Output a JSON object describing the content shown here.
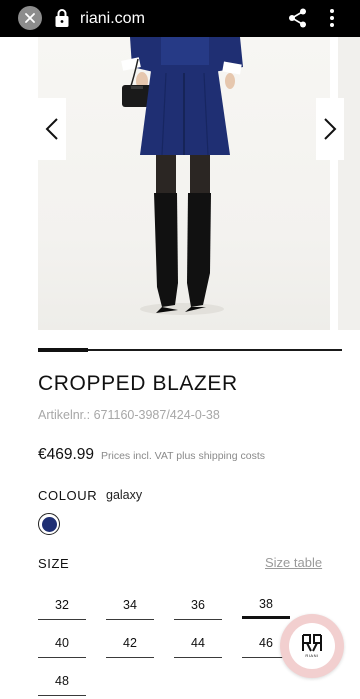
{
  "browser": {
    "url": "riani.com"
  },
  "product": {
    "title": "CROPPED BLAZER",
    "article": "Artikelnr.: 671160-3987/424-0-38",
    "price": "€469.99",
    "price_note": "Prices incl. VAT plus shipping costs",
    "colour_label": "COLOUR",
    "colour_name": "galaxy",
    "colour_swatch": "#1f2f73",
    "size_label": "SIZE",
    "size_table_link": "Size table",
    "sizes": [
      "32",
      "34",
      "36",
      "38",
      "40",
      "42",
      "44",
      "46",
      "48"
    ],
    "selected_size": "38"
  },
  "badge": {
    "brand_text": "RIANI",
    "background": "#f2cfcf"
  },
  "colors": {
    "skirt_navy": "#1f2f73"
  }
}
